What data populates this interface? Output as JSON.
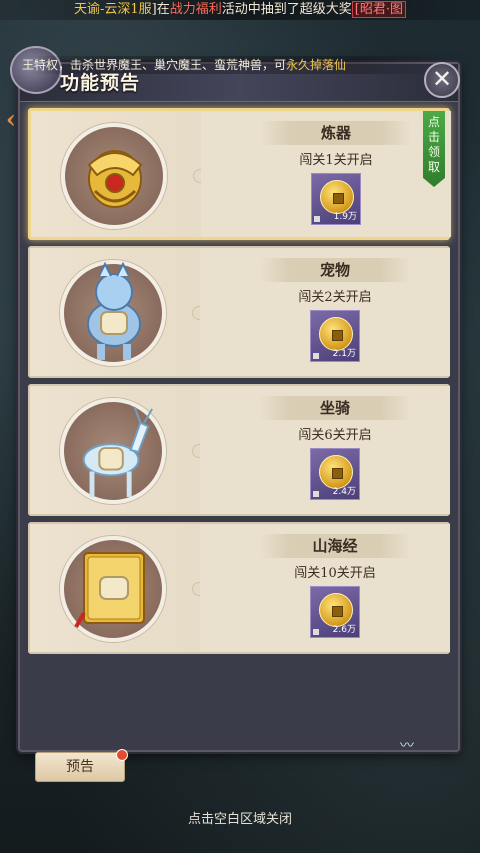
{
  "ticker": {
    "player": "天谕-云深1服",
    "bracket_open": "[",
    "bracket_close": "]",
    "prefix": "在",
    "event": "战力福利",
    "mid": "活动中抽到了超级大奖",
    "prize": "[昭君·图"
  },
  "panel": {
    "title": "功能预告",
    "scroll_text_a": "王特权，击杀世界魔王、巢穴魔王、蛮荒神兽，可",
    "scroll_text_b": "永久掉落仙",
    "close_symbol": "✕"
  },
  "features": [
    {
      "name": "炼器",
      "unlock": "闯关1关开启",
      "reward_amount": "1.9万",
      "claimable": true,
      "claim_label": "点击领取"
    },
    {
      "name": "宠物",
      "unlock": "闯关2关开启",
      "reward_amount": "2.1万",
      "claimable": false
    },
    {
      "name": "坐骑",
      "unlock": "闯关6关开启",
      "reward_amount": "2.4万",
      "claimable": false
    },
    {
      "name": "山海经",
      "unlock": "闯关10关开启",
      "reward_amount": "2.6万",
      "claimable": false
    }
  ],
  "footer": {
    "preview_button": "预告",
    "close_hint": "点击空白区域关闭"
  },
  "icons": {
    "feature_0": "armor-icon",
    "feature_1": "pet-kirin-icon",
    "feature_2": "deer-mount-icon",
    "feature_3": "golden-book-icon",
    "reward": "gold-coin-icon"
  },
  "colors": {
    "accent_gold": "#f0c64b",
    "claim_green": "#3f9a3a",
    "card_bg": "#efe7d6",
    "panel_bg": "#3b3c4a"
  }
}
